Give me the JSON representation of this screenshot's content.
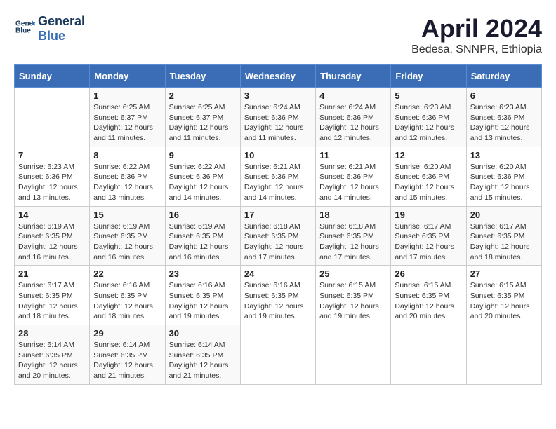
{
  "logo": {
    "line1": "General",
    "line2": "Blue"
  },
  "title": "April 2024",
  "location": "Bedesa, SNNPR, Ethiopia",
  "days_of_week": [
    "Sunday",
    "Monday",
    "Tuesday",
    "Wednesday",
    "Thursday",
    "Friday",
    "Saturday"
  ],
  "weeks": [
    [
      {
        "day": "",
        "sunrise": "",
        "sunset": "",
        "daylight": ""
      },
      {
        "day": "1",
        "sunrise": "Sunrise: 6:25 AM",
        "sunset": "Sunset: 6:37 PM",
        "daylight": "Daylight: 12 hours and 11 minutes."
      },
      {
        "day": "2",
        "sunrise": "Sunrise: 6:25 AM",
        "sunset": "Sunset: 6:37 PM",
        "daylight": "Daylight: 12 hours and 11 minutes."
      },
      {
        "day": "3",
        "sunrise": "Sunrise: 6:24 AM",
        "sunset": "Sunset: 6:36 PM",
        "daylight": "Daylight: 12 hours and 11 minutes."
      },
      {
        "day": "4",
        "sunrise": "Sunrise: 6:24 AM",
        "sunset": "Sunset: 6:36 PM",
        "daylight": "Daylight: 12 hours and 12 minutes."
      },
      {
        "day": "5",
        "sunrise": "Sunrise: 6:23 AM",
        "sunset": "Sunset: 6:36 PM",
        "daylight": "Daylight: 12 hours and 12 minutes."
      },
      {
        "day": "6",
        "sunrise": "Sunrise: 6:23 AM",
        "sunset": "Sunset: 6:36 PM",
        "daylight": "Daylight: 12 hours and 13 minutes."
      }
    ],
    [
      {
        "day": "7",
        "sunrise": "Sunrise: 6:23 AM",
        "sunset": "Sunset: 6:36 PM",
        "daylight": "Daylight: 12 hours and 13 minutes."
      },
      {
        "day": "8",
        "sunrise": "Sunrise: 6:22 AM",
        "sunset": "Sunset: 6:36 PM",
        "daylight": "Daylight: 12 hours and 13 minutes."
      },
      {
        "day": "9",
        "sunrise": "Sunrise: 6:22 AM",
        "sunset": "Sunset: 6:36 PM",
        "daylight": "Daylight: 12 hours and 14 minutes."
      },
      {
        "day": "10",
        "sunrise": "Sunrise: 6:21 AM",
        "sunset": "Sunset: 6:36 PM",
        "daylight": "Daylight: 12 hours and 14 minutes."
      },
      {
        "day": "11",
        "sunrise": "Sunrise: 6:21 AM",
        "sunset": "Sunset: 6:36 PM",
        "daylight": "Daylight: 12 hours and 14 minutes."
      },
      {
        "day": "12",
        "sunrise": "Sunrise: 6:20 AM",
        "sunset": "Sunset: 6:36 PM",
        "daylight": "Daylight: 12 hours and 15 minutes."
      },
      {
        "day": "13",
        "sunrise": "Sunrise: 6:20 AM",
        "sunset": "Sunset: 6:36 PM",
        "daylight": "Daylight: 12 hours and 15 minutes."
      }
    ],
    [
      {
        "day": "14",
        "sunrise": "Sunrise: 6:19 AM",
        "sunset": "Sunset: 6:35 PM",
        "daylight": "Daylight: 12 hours and 16 minutes."
      },
      {
        "day": "15",
        "sunrise": "Sunrise: 6:19 AM",
        "sunset": "Sunset: 6:35 PM",
        "daylight": "Daylight: 12 hours and 16 minutes."
      },
      {
        "day": "16",
        "sunrise": "Sunrise: 6:19 AM",
        "sunset": "Sunset: 6:35 PM",
        "daylight": "Daylight: 12 hours and 16 minutes."
      },
      {
        "day": "17",
        "sunrise": "Sunrise: 6:18 AM",
        "sunset": "Sunset: 6:35 PM",
        "daylight": "Daylight: 12 hours and 17 minutes."
      },
      {
        "day": "18",
        "sunrise": "Sunrise: 6:18 AM",
        "sunset": "Sunset: 6:35 PM",
        "daylight": "Daylight: 12 hours and 17 minutes."
      },
      {
        "day": "19",
        "sunrise": "Sunrise: 6:17 AM",
        "sunset": "Sunset: 6:35 PM",
        "daylight": "Daylight: 12 hours and 17 minutes."
      },
      {
        "day": "20",
        "sunrise": "Sunrise: 6:17 AM",
        "sunset": "Sunset: 6:35 PM",
        "daylight": "Daylight: 12 hours and 18 minutes."
      }
    ],
    [
      {
        "day": "21",
        "sunrise": "Sunrise: 6:17 AM",
        "sunset": "Sunset: 6:35 PM",
        "daylight": "Daylight: 12 hours and 18 minutes."
      },
      {
        "day": "22",
        "sunrise": "Sunrise: 6:16 AM",
        "sunset": "Sunset: 6:35 PM",
        "daylight": "Daylight: 12 hours and 18 minutes."
      },
      {
        "day": "23",
        "sunrise": "Sunrise: 6:16 AM",
        "sunset": "Sunset: 6:35 PM",
        "daylight": "Daylight: 12 hours and 19 minutes."
      },
      {
        "day": "24",
        "sunrise": "Sunrise: 6:16 AM",
        "sunset": "Sunset: 6:35 PM",
        "daylight": "Daylight: 12 hours and 19 minutes."
      },
      {
        "day": "25",
        "sunrise": "Sunrise: 6:15 AM",
        "sunset": "Sunset: 6:35 PM",
        "daylight": "Daylight: 12 hours and 19 minutes."
      },
      {
        "day": "26",
        "sunrise": "Sunrise: 6:15 AM",
        "sunset": "Sunset: 6:35 PM",
        "daylight": "Daylight: 12 hours and 20 minutes."
      },
      {
        "day": "27",
        "sunrise": "Sunrise: 6:15 AM",
        "sunset": "Sunset: 6:35 PM",
        "daylight": "Daylight: 12 hours and 20 minutes."
      }
    ],
    [
      {
        "day": "28",
        "sunrise": "Sunrise: 6:14 AM",
        "sunset": "Sunset: 6:35 PM",
        "daylight": "Daylight: 12 hours and 20 minutes."
      },
      {
        "day": "29",
        "sunrise": "Sunrise: 6:14 AM",
        "sunset": "Sunset: 6:35 PM",
        "daylight": "Daylight: 12 hours and 21 minutes."
      },
      {
        "day": "30",
        "sunrise": "Sunrise: 6:14 AM",
        "sunset": "Sunset: 6:35 PM",
        "daylight": "Daylight: 12 hours and 21 minutes."
      },
      {
        "day": "",
        "sunrise": "",
        "sunset": "",
        "daylight": ""
      },
      {
        "day": "",
        "sunrise": "",
        "sunset": "",
        "daylight": ""
      },
      {
        "day": "",
        "sunrise": "",
        "sunset": "",
        "daylight": ""
      },
      {
        "day": "",
        "sunrise": "",
        "sunset": "",
        "daylight": ""
      }
    ]
  ]
}
